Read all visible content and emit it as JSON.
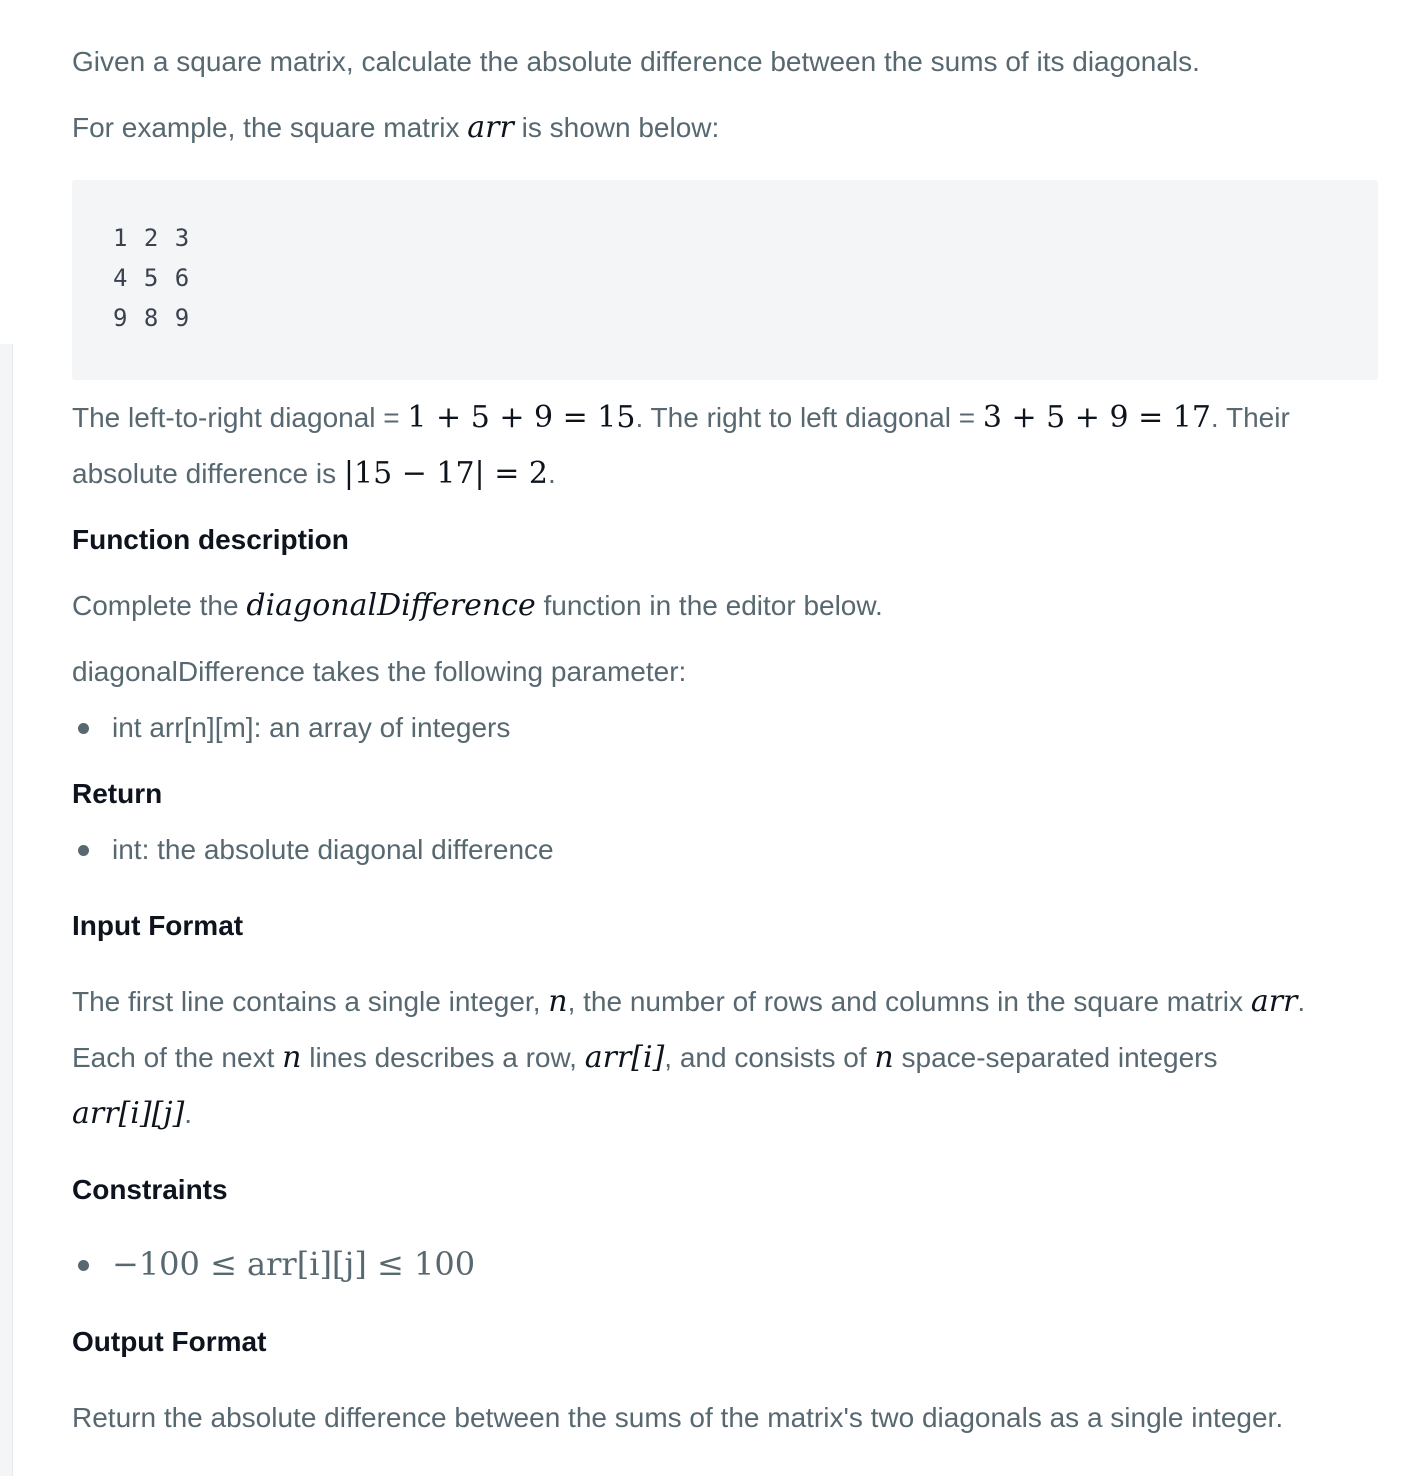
{
  "intro": "Given a square matrix, calculate the absolute difference between the sums of its diagonals.",
  "example": {
    "prefix": "For example, the square matrix ",
    "var": "arr",
    "suffix": " is shown below:"
  },
  "matrix_rows": [
    "1 2 3",
    "4 5 6",
    "9 8 9"
  ],
  "diagonals": {
    "t1": "The left-to-right diagonal = ",
    "m1": "1 + 5 + 9 = 15",
    "t2": ". The right to left diagonal = ",
    "m2": "3 + 5 + 9 = 17",
    "t3": ". Their",
    "t4": "absolute difference is ",
    "m3": "|15 − 17| = 2",
    "t5": "."
  },
  "function_description": {
    "heading": "Function description",
    "p1_prefix": "Complete the ",
    "p1_math": "diagonalDifference",
    "p1_suffix": " function in the editor below.",
    "p2": "diagonalDifference takes the following parameter:",
    "params": [
      "int arr[n][m]: an array of integers"
    ]
  },
  "return": {
    "heading": "Return",
    "items": [
      "int: the absolute diagonal difference"
    ]
  },
  "input_format": {
    "heading": "Input Format",
    "l1_a": "The first line contains a single integer, ",
    "l1_n": "n",
    "l1_b": ", the number of rows and columns in the square matrix ",
    "l1_arr": "arr",
    "l1_c": ".",
    "l2_a": "Each of the next ",
    "l2_n": "n",
    "l2_b": " lines describes a row, ",
    "l2_arr": "arr[i]",
    "l2_c": ", and consists of ",
    "l2_n2": "n",
    "l2_d": " space-separated integers",
    "l3_arr": "arr[i][j]",
    "l3_c": "."
  },
  "constraints": {
    "heading": "Constraints",
    "items": [
      "−100 ≤ arr[i][j] ≤ 100"
    ]
  },
  "output_format": {
    "heading": "Output Format",
    "text": "Return the absolute difference between the sums of the matrix's two diagonals as a single integer."
  }
}
